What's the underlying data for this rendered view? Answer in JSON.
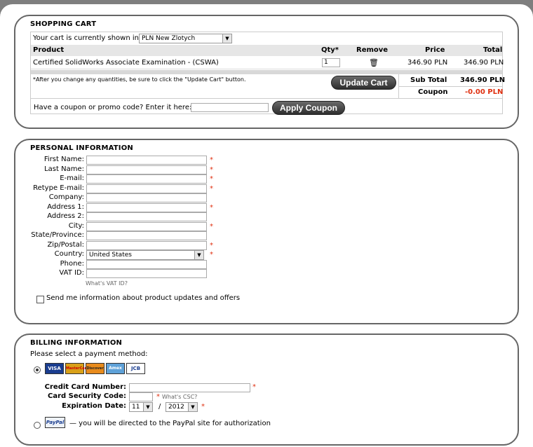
{
  "cart": {
    "title": "SHOPPING CART",
    "currency_prefix": "Your cart is currently shown in",
    "currency_selected": "PLN New Zlotych",
    "headers": {
      "product": "Product",
      "qty": "Qty*",
      "remove": "Remove",
      "price": "Price",
      "total": "Total"
    },
    "items": [
      {
        "product": "Certified SolidWorks Associate Examination - (CSWA)",
        "qty": "1",
        "remove_icon": "trash-icon",
        "price": "346.90 PLN",
        "total": "346.90 PLN"
      }
    ],
    "note": "*After you change any quantities, be sure to click the \"Update Cart\" button.",
    "update_button": "Update Cart",
    "subtotal_label": "Sub Total",
    "subtotal_value": "346.90 PLN",
    "coupon_label": "Coupon",
    "coupon_value": "-0.00 PLN",
    "coupon_prompt": "Have a coupon or promo code? Enter it here:",
    "coupon_input": "",
    "apply_button": "Apply Coupon"
  },
  "personal": {
    "title": "PERSONAL INFORMATION",
    "fields": [
      {
        "label": "First Name:",
        "value": "",
        "required": true
      },
      {
        "label": "Last Name:",
        "value": "",
        "required": true
      },
      {
        "label": "E-mail:",
        "value": "",
        "required": true
      },
      {
        "label": "Retype E-mail:",
        "value": "",
        "required": true
      },
      {
        "label": "Company:",
        "value": "",
        "required": false
      },
      {
        "label": "Address 1:",
        "value": "",
        "required": true
      },
      {
        "label": "Address 2:",
        "value": "",
        "required": false
      },
      {
        "label": "City:",
        "value": "",
        "required": true
      },
      {
        "label": "State/Province:",
        "value": "",
        "required": false
      },
      {
        "label": "Zip/Postal:",
        "value": "",
        "required": true
      },
      {
        "label": "Country:",
        "value": "United States",
        "required": true,
        "type": "select"
      },
      {
        "label": "Phone:",
        "value": "",
        "required": false
      },
      {
        "label": "VAT ID:",
        "value": "",
        "required": false
      }
    ],
    "vat_help": "What's VAT ID?",
    "required_mark": "*",
    "newsletter_label": "Send me information about product updates and offers"
  },
  "billing": {
    "title": "BILLING INFORMATION",
    "prompt": "Please select a payment method:",
    "cards": [
      "VISA",
      "MasterCard",
      "Discover",
      "Amex",
      "JCB"
    ],
    "cc_number_label": "Credit Card Number:",
    "csc_label": "Card Security Code:",
    "csc_help": "What's CSC?",
    "exp_label": "Expiration Date:",
    "exp_month": "11",
    "exp_sep": "/",
    "exp_year": "2012",
    "paypal_logo": "PayPal",
    "paypal_text": "— you will be directed to the PayPal site for authorization"
  }
}
